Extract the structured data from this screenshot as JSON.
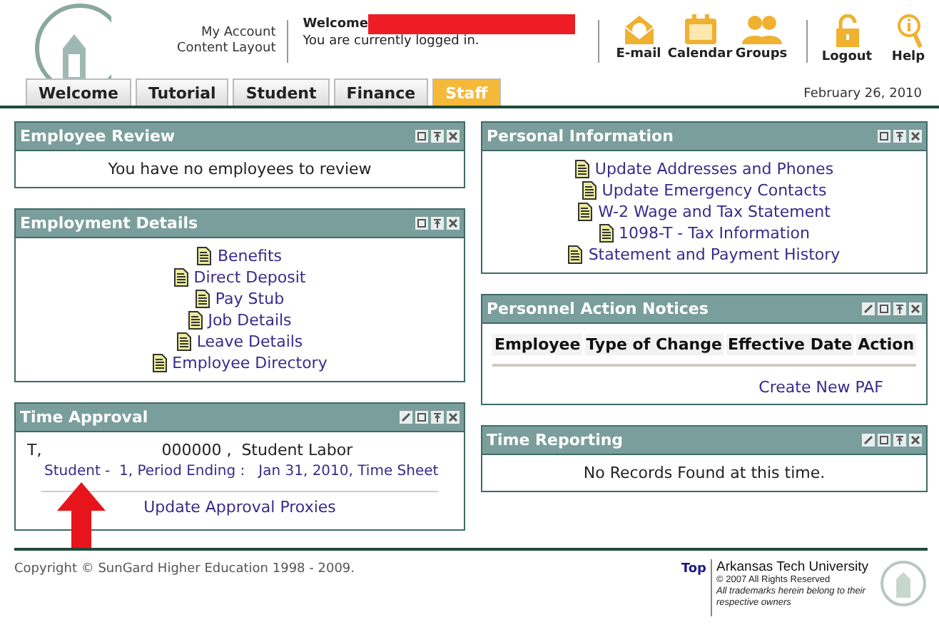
{
  "header": {
    "account_links": [
      "My Account",
      "Content Layout"
    ],
    "welcome": "Welcome",
    "status": "You are currently logged in.",
    "tool_groups": [
      [
        {
          "label": "E-mail",
          "kind": "email"
        },
        {
          "label": "Calendar",
          "kind": "calendar"
        },
        {
          "label": "Groups",
          "kind": "groups"
        }
      ],
      [
        {
          "label": "Logout",
          "kind": "logout"
        },
        {
          "label": "Help",
          "kind": "help"
        }
      ]
    ]
  },
  "tabs": [
    {
      "label": "Welcome",
      "selected": false
    },
    {
      "label": "Tutorial",
      "selected": false
    },
    {
      "label": "Student",
      "selected": false
    },
    {
      "label": "Finance",
      "selected": false
    },
    {
      "label": "Staff",
      "selected": true
    }
  ],
  "date": "February 26, 2010",
  "columns": [
    [
      {
        "title": "Employee Review",
        "kind": "message",
        "editable": false,
        "message": "You have no employees to review"
      },
      {
        "title": "Employment Details",
        "kind": "links",
        "editable": false,
        "links": [
          "Benefits",
          "Direct Deposit",
          "Pay Stub",
          "Job Details",
          "Leave Details",
          "Employee Directory"
        ]
      },
      {
        "title": "Time Approval",
        "kind": "time_approval",
        "editable": true,
        "name": "T,",
        "id_line": "000000 ,  Student Labor",
        "sheet_link": "Student -  1, Period Ending :   Jan 31, 2010, Time Sheet",
        "proxies_link": "Update Approval Proxies"
      }
    ],
    [
      {
        "title": "Personal Information",
        "kind": "links",
        "editable": false,
        "links": [
          "Update Addresses and Phones",
          "Update Emergency Contacts",
          "W-2 Wage and Tax Statement",
          "1098-T - Tax Information",
          "Statement and Payment History"
        ]
      },
      {
        "title": "Personnel Action Notices",
        "kind": "table",
        "editable": true,
        "columns": [
          "Employee",
          "Type of Change",
          "Effective Date",
          "Action"
        ],
        "link": "Create New PAF"
      },
      {
        "title": "Time Reporting",
        "kind": "message",
        "editable": true,
        "message": "No Records Found at this time."
      }
    ]
  ],
  "footer": {
    "copyright": "Copyright © SunGard Higher Education 1998 - 2009.",
    "top_link": "Top",
    "university": "Arkansas Tech University",
    "rights": "© 2007 All Rights Reserved",
    "trademark": "All trademarks herein belong to their respective owners"
  }
}
